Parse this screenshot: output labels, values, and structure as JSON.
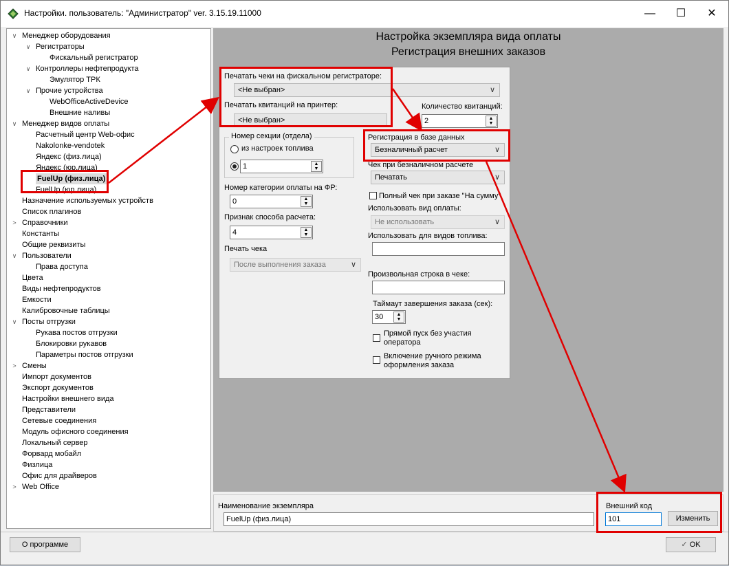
{
  "window": {
    "title": "Настройки. пользователь: \"Администратор\" ver. 3.15.19.11000",
    "minimize": "—",
    "maximize": "☐",
    "close": "✕"
  },
  "tree": [
    {
      "label": "Менеджер оборудования",
      "toggle": "∨"
    },
    {
      "label": "Регистраторы",
      "toggle": "∨"
    },
    {
      "label": "Фискальный регистратор"
    },
    {
      "label": "Контроллеры нефтепродукта",
      "toggle": "∨"
    },
    {
      "label": "Эмулятор ТРК"
    },
    {
      "label": "Прочие устройства",
      "toggle": "∨"
    },
    {
      "label": "WebOfficeActiveDevice"
    },
    {
      "label": "Внешние наливы"
    },
    {
      "label": "Менеджер видов оплаты",
      "toggle": "∨"
    },
    {
      "label": "Расчетный центр Web-офис"
    },
    {
      "label": "Nakolonke-vendotek"
    },
    {
      "label": "Яндекс (физ.лица)"
    },
    {
      "label": "Яндекс (юр.лица)"
    },
    {
      "label": "FuelUp (физ.лица)"
    },
    {
      "label": "FuelUp (юр.лица)"
    },
    {
      "label": "Назначение используемых устройств"
    },
    {
      "label": "Список плагинов"
    },
    {
      "label": "Справочники",
      "toggle": ">"
    },
    {
      "label": "Константы"
    },
    {
      "label": "Общие реквизиты"
    },
    {
      "label": "Пользователи",
      "toggle": "∨"
    },
    {
      "label": "Права доступа"
    },
    {
      "label": "Цвета"
    },
    {
      "label": "Виды нефтепродуктов"
    },
    {
      "label": "Емкости"
    },
    {
      "label": "Калибровочные таблицы"
    },
    {
      "label": "Посты отгрузки",
      "toggle": "∨"
    },
    {
      "label": "Рукава постов отгрузки"
    },
    {
      "label": "Блокировки рукавов"
    },
    {
      "label": "Параметры постов отгрузки"
    },
    {
      "label": "Смены",
      "toggle": ">"
    },
    {
      "label": "Импорт документов"
    },
    {
      "label": "Экспорт документов"
    },
    {
      "label": "Настройки внешнего вида"
    },
    {
      "label": "Представители"
    },
    {
      "label": "Сетевые соединения"
    },
    {
      "label": "Модуль офисного соединения"
    },
    {
      "label": "Локальный сервер"
    },
    {
      "label": "Форвард мобайл"
    },
    {
      "label": "Физлица"
    },
    {
      "label": "Офис для драйверов"
    },
    {
      "label": "Web Office",
      "toggle": ">"
    }
  ],
  "panel": {
    "header1": "Настройка экземпляра вида оплаты",
    "header2": "Регистрация внешних заказов"
  },
  "form": {
    "print_fiscal_label": "Печатать чеки на фискальном регистраторе:",
    "print_fiscal_value": "<Не выбран>",
    "print_receipt_label": "Печатать квитанций на принтер:",
    "print_receipt_value": "<Не выбран>",
    "receipt_count_label": "Количество квитанций:",
    "receipt_count_value": "2",
    "section_group_label": "Номер секции (отдела)",
    "from_fuel_label": "из настроек топлива",
    "section_value": "1",
    "payment_category_label": "Номер категории оплаты на ФР:",
    "payment_category_value": "0",
    "calc_method_label": "Признак способа расчета:",
    "calc_method_value": "4",
    "print_check_label": "Печать чека",
    "print_check_value": "После выполнения заказа",
    "db_registration_label": "Регистрация в базе данных",
    "db_registration_value": "Безналичный расчет",
    "cashless_check_label": "Чек при безналичном расчете",
    "cashless_check_value": "Печатать",
    "full_check_label": "Полный чек при заказе \"На сумму\"",
    "use_payment_label": "Использовать вид оплаты:",
    "use_payment_value": "Не использовать",
    "use_fuel_label": "Использовать для видов топлива:",
    "use_fuel_value": "",
    "custom_line_label": "Произвольная строка в чеке:",
    "custom_line_value": "",
    "timeout_label": "Таймаут завершения заказа (сек):",
    "timeout_value": "30",
    "direct_start_label": "Прямой пуск без участия оператора",
    "manual_mode_label": "Включение ручного режима оформления заказа"
  },
  "bottom": {
    "instance_name_label": "Наименование экземпляра",
    "instance_name_value": "FuelUp (физ.лица)",
    "external_code_label": "Внешний код",
    "external_code_value": "101",
    "change_button": "Изменить"
  },
  "footer": {
    "about_button": "О программе",
    "ok_button": "OK"
  },
  "colors": {
    "annotation": "#e00000"
  },
  "icons": {
    "ok": "check-icon",
    "dropdown": "chevron-down-icon"
  }
}
